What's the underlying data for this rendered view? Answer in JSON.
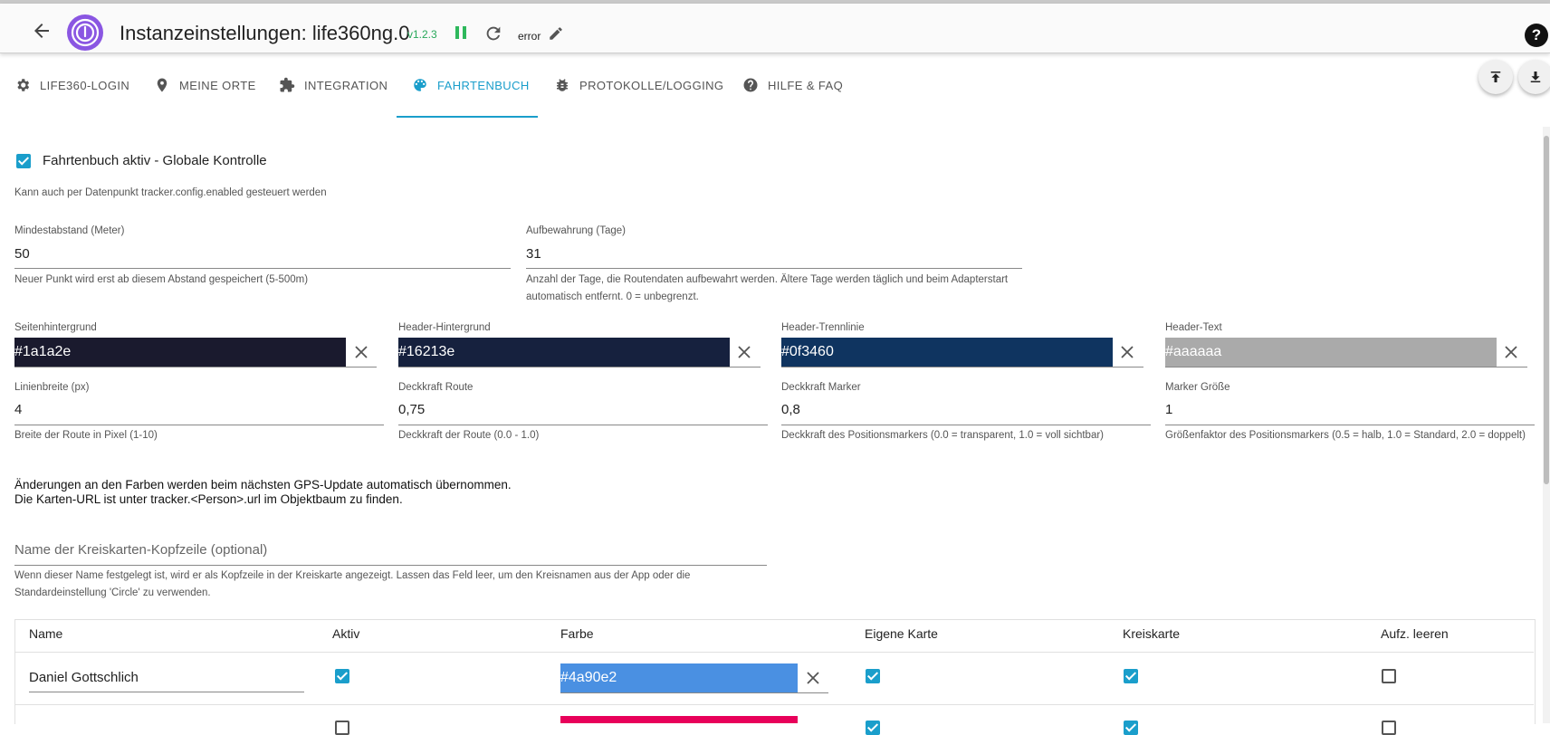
{
  "header": {
    "title": "Instanzeinstellungen: life360ng.0",
    "version": "v1.2.3",
    "status": "error",
    "help": "?"
  },
  "tabs": [
    {
      "label": "LIFE360-LOGIN",
      "icon": "gear-icon"
    },
    {
      "label": "MEINE ORTE",
      "icon": "location-pin-icon"
    },
    {
      "label": "INTEGRATION",
      "icon": "puzzle-icon"
    },
    {
      "label": "FAHRTENBUCH",
      "icon": "palette-icon",
      "active": true
    },
    {
      "label": "PROTOKOLLE/LOGGING",
      "icon": "bug-icon"
    },
    {
      "label": "HILFE & FAQ",
      "icon": "help-circle-icon"
    }
  ],
  "global": {
    "enabled_label": "Fahrtenbuch aktiv - Globale Kontrolle",
    "enabled": true,
    "helper": "Kann auch per Datenpunkt tracker.config.enabled gesteuert werden"
  },
  "fields": {
    "min_distance": {
      "label": "Mindestabstand (Meter)",
      "value": "50",
      "helper": "Neuer Punkt wird erst ab diesem Abstand gespeichert (5-500m)"
    },
    "retention": {
      "label": "Aufbewahrung (Tage)",
      "value": "31",
      "helper": "Anzahl der Tage, die Routendaten aufbewahrt werden. Ältere Tage werden täglich und beim Adapterstart automatisch entfernt. 0 = unbegrenzt."
    },
    "page_bg": {
      "label": "Seitenhintergrund",
      "value": "#1a1a2e"
    },
    "header_bg": {
      "label": "Header-Hintergrund",
      "value": "#16213e"
    },
    "header_divider": {
      "label": "Header-Trennlinie",
      "value": "#0f3460"
    },
    "header_text": {
      "label": "Header-Text",
      "value": "#aaaaaa"
    },
    "line_width": {
      "label": "Linienbreite (px)",
      "value": "4",
      "helper": "Breite der Route in Pixel (1-10)"
    },
    "route_opacity": {
      "label": "Deckkraft Route",
      "value": "0,75",
      "helper": "Deckkraft der Route (0.0 - 1.0)"
    },
    "marker_opacity": {
      "label": "Deckkraft Marker",
      "value": "0,8",
      "helper": "Deckkraft des Positionsmarkers (0.0 = transparent, 1.0 = voll sichtbar)"
    },
    "marker_size": {
      "label": "Marker Größe",
      "value": "1",
      "helper": "Größenfaktor des Positionsmarkers (0.5 = halb, 1.0 = Standard, 2.0 = doppelt)"
    }
  },
  "info": {
    "line1": "Änderungen an den Farben werden beim nächsten GPS-Update automatisch übernommen.",
    "line2": "Die Karten-URL ist unter tracker.<Person>.url im Objektbaum zu finden."
  },
  "circle_header": {
    "placeholder": "Name der Kreiskarten-Kopfzeile (optional)",
    "helper": "Wenn dieser Name festgelegt ist, wird er als Kopfzeile in der Kreiskarte angezeigt. Lassen das Feld leer, um den Kreisnamen aus der App oder die Standardeinstellung 'Circle' zu verwenden."
  },
  "table": {
    "columns": [
      "Name",
      "Aktiv",
      "Farbe",
      "Eigene Karte",
      "Kreiskarte",
      "Aufz. leeren"
    ],
    "rows": [
      {
        "name": "Daniel Gottschlich",
        "active": true,
        "color": "#4a90e2",
        "own_map": true,
        "circle_map": true,
        "clear": false
      },
      {
        "name": "",
        "active": false,
        "color": "#e8005a",
        "own_map": true,
        "circle_map": true,
        "clear": false
      }
    ]
  }
}
